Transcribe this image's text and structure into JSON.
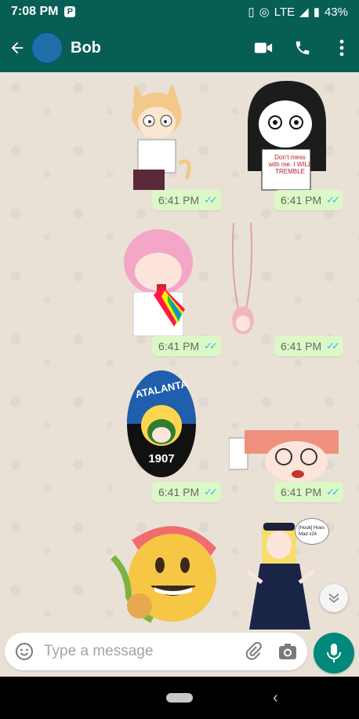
{
  "status_bar": {
    "time": "7:08 PM",
    "app_badge": "P",
    "network": "LTE",
    "battery": "43%"
  },
  "header": {
    "contact_name": "Bob"
  },
  "messages": [
    {
      "time": "6:41 PM",
      "status": "read"
    },
    {
      "time": "6:41 PM",
      "status": "read"
    },
    {
      "time": "6:41 PM",
      "status": "read"
    },
    {
      "time": "6:41 PM",
      "status": "read"
    },
    {
      "time": "6:41 PM",
      "status": "read"
    },
    {
      "time": "6:41 PM",
      "status": "read"
    }
  ],
  "stickers": {
    "shirt_text": "Don't mess with me. I WILL TREMBLE",
    "badge_text_top": "ATALANTA",
    "badge_text_bottom": "1907",
    "bubble_text": "[Hook] Hoes Mad x24"
  },
  "composer": {
    "placeholder": "Type a message"
  },
  "colors": {
    "header": "#075e54",
    "bubble": "#dcf8c6",
    "ticks": "#34b7f1",
    "mic": "#00897b",
    "chat_bg": "#e9e1d6"
  }
}
